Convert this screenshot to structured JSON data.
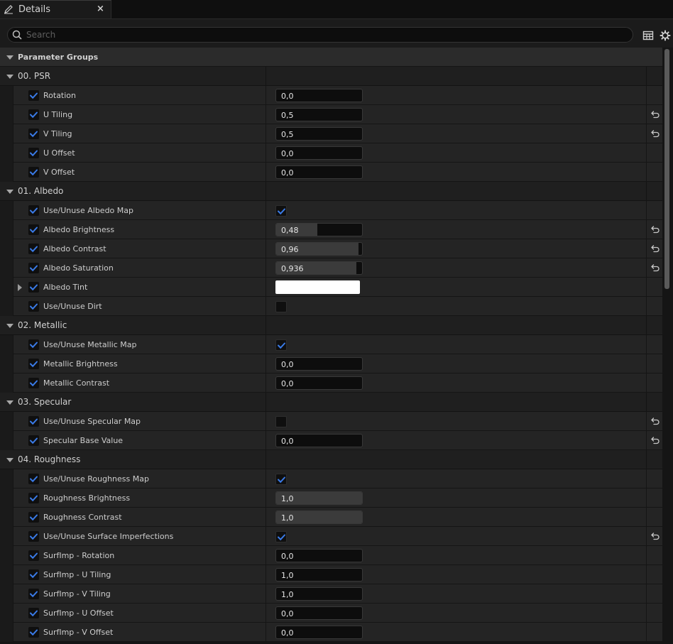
{
  "tab": {
    "title": "Details",
    "close": "×",
    "icon": "pencil-icon"
  },
  "search": {
    "placeholder": "Search",
    "value": ""
  },
  "toolbar": {
    "view_options_icon": "table-icon",
    "settings_icon": "gear-icon"
  },
  "parameter_groups": {
    "label": "Parameter Groups",
    "expanded": true
  },
  "colors": {
    "accent_check": "#3a7be8",
    "tint": "#ffffff"
  },
  "groups": [
    {
      "label": "00. PSR",
      "expanded": true,
      "rows": [
        {
          "label": "Rotation",
          "kind": "number",
          "value": "0,0",
          "enabled": true,
          "reset": false
        },
        {
          "label": "U Tiling",
          "kind": "number",
          "value": "0,5",
          "enabled": true,
          "reset": true
        },
        {
          "label": "V Tiling",
          "kind": "number",
          "value": "0,5",
          "enabled": true,
          "reset": true
        },
        {
          "label": "U Offset",
          "kind": "number",
          "value": "0,0",
          "enabled": true,
          "reset": false
        },
        {
          "label": "V Offset",
          "kind": "number",
          "value": "0,0",
          "enabled": true,
          "reset": false
        }
      ]
    },
    {
      "label": "01. Albedo",
      "expanded": true,
      "rows": [
        {
          "label": "Use/Unuse Albedo Map",
          "kind": "check",
          "checked": true,
          "enabled": true,
          "reset": false
        },
        {
          "label": "Albedo Brightness",
          "kind": "slider",
          "value": "0,48",
          "fraction": 0.48,
          "enabled": true,
          "reset": true
        },
        {
          "label": "Albedo Contrast",
          "kind": "slider",
          "value": "0,96",
          "fraction": 0.96,
          "enabled": true,
          "reset": true
        },
        {
          "label": "Albedo Saturation",
          "kind": "slider",
          "value": "0,936",
          "fraction": 0.936,
          "enabled": true,
          "reset": true
        },
        {
          "label": "Albedo Tint",
          "kind": "color",
          "color": "#ffffff",
          "expandable": true,
          "enabled": true,
          "reset": false
        },
        {
          "label": "Use/Unuse Dirt",
          "kind": "check",
          "checked": false,
          "enabled": true,
          "reset": false
        }
      ]
    },
    {
      "label": "02. Metallic",
      "expanded": true,
      "rows": [
        {
          "label": "Use/Unuse Metallic Map",
          "kind": "check",
          "checked": true,
          "enabled": true,
          "reset": false
        },
        {
          "label": "Metallic Brightness",
          "kind": "number",
          "value": "0,0",
          "enabled": true,
          "reset": false
        },
        {
          "label": "Metallic Contrast",
          "kind": "number",
          "value": "0,0",
          "enabled": true,
          "reset": false
        }
      ]
    },
    {
      "label": "03. Specular",
      "expanded": true,
      "rows": [
        {
          "label": "Use/Unuse Specular Map",
          "kind": "check",
          "checked": false,
          "enabled": true,
          "reset": true
        },
        {
          "label": "Specular Base Value",
          "kind": "number",
          "value": "0,0",
          "enabled": true,
          "reset": true
        }
      ]
    },
    {
      "label": "04. Roughness",
      "expanded": true,
      "rows": [
        {
          "label": "Use/Unuse Roughness Map",
          "kind": "check",
          "checked": true,
          "enabled": true,
          "reset": false
        },
        {
          "label": "Roughness Brightness",
          "kind": "slider",
          "value": "1,0",
          "fraction": 1.0,
          "enabled": true,
          "reset": false
        },
        {
          "label": "Roughness Contrast",
          "kind": "slider",
          "value": "1,0",
          "fraction": 1.0,
          "enabled": true,
          "reset": false
        },
        {
          "label": "Use/Unuse Surface Imperfections",
          "kind": "check",
          "checked": true,
          "enabled": true,
          "reset": true
        },
        {
          "label": "SurfImp - Rotation",
          "kind": "number",
          "value": "0,0",
          "enabled": true,
          "reset": false
        },
        {
          "label": "SurfImp - U Tiling",
          "kind": "number",
          "value": "1,0",
          "enabled": true,
          "reset": false
        },
        {
          "label": "SurfImp - V Tiling",
          "kind": "number",
          "value": "1,0",
          "enabled": true,
          "reset": false
        },
        {
          "label": "SurfImp - U Offset",
          "kind": "number",
          "value": "0,0",
          "enabled": true,
          "reset": false
        },
        {
          "label": "SurfImp - V Offset",
          "kind": "number",
          "value": "0,0",
          "enabled": true,
          "reset": false
        }
      ]
    }
  ]
}
